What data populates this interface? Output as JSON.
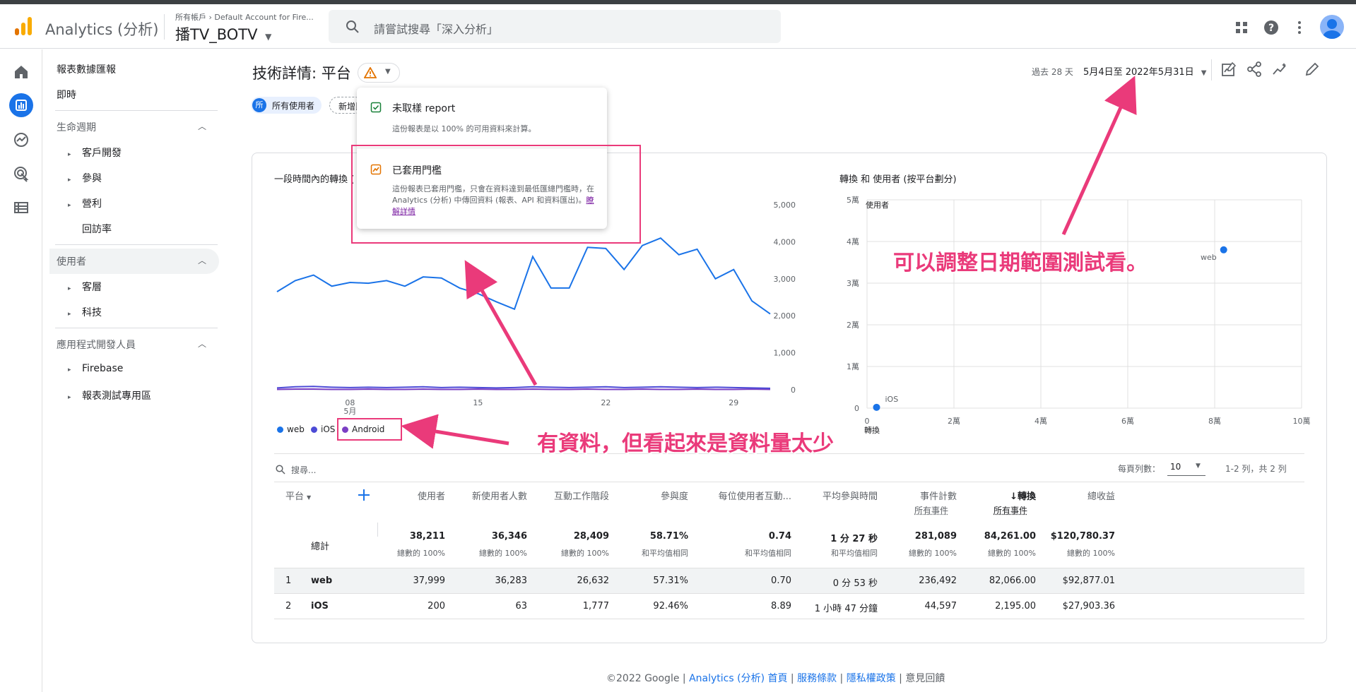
{
  "header": {
    "app_title": "Analytics (分析)",
    "account_path": "所有帳戶 › Default Account for Fire...",
    "property_name": "播TV_BOTV",
    "search_placeholder": "請嘗試搜尋「深入分析」",
    "icons": [
      "apps-icon",
      "help-icon",
      "more-vert-icon",
      "avatar"
    ]
  },
  "rail": [
    "home-icon",
    "reports-icon",
    "explore-icon",
    "advertising-icon",
    "configure-icon"
  ],
  "nav": {
    "reports_snapshot": "報表數據匯報",
    "realtime": "即時",
    "lifecycle": "生命週期",
    "acquisition": "客戶開發",
    "engagement": "參與",
    "monetization": "營利",
    "retention": "回訪率",
    "user": "使用者",
    "demographics": "客層",
    "tech": "科技",
    "app_developer": "應用程式開發人員",
    "firebase": "Firebase",
    "debug": "報表測試專用區"
  },
  "page": {
    "title": "技術詳情: 平台",
    "chip_users_badge": "所",
    "chip_users": "所有使用者",
    "chip_add": "新增比",
    "date_prefix": "過去 28 天",
    "date_range": "5月4日至 2022年5月31日"
  },
  "popup": {
    "unsampled_title": "未取樣 report",
    "unsampled_desc": "這份報表是以 100% 的可用資料來計算。",
    "threshold_title": "已套用門檻",
    "threshold_desc": "這份報表已套用門檻，只會在資料達到最低匯總門檻時，在 Analytics (分析) 中傳回資料 (報表、API 和資料匯出)。",
    "threshold_link": "瞭解詳情"
  },
  "charts": {
    "line_title": "一段時間內的轉換 (",
    "scatter_title": "轉換 和 使用者 (按平台劃分)",
    "legend": [
      {
        "name": "web",
        "color": "#1a73e8"
      },
      {
        "name": "iOS",
        "color": "#4c4bd6"
      },
      {
        "name": "Android",
        "color": "#7b3fc4"
      }
    ]
  },
  "chart_data": [
    {
      "type": "line",
      "x_tick_labels": [
        "08",
        "15",
        "22",
        "29"
      ],
      "x_month_label": "5月",
      "y_tick_labels": [
        "5,000",
        "4,000",
        "3,000",
        "2,000",
        "1,000",
        "0"
      ],
      "ylim": [
        0,
        5000
      ],
      "grid": false,
      "series": [
        {
          "name": "web",
          "color": "#1a73e8",
          "values": [
            2650,
            2950,
            3100,
            2800,
            2900,
            2880,
            2950,
            2800,
            3050,
            3020,
            2750,
            2600,
            2380,
            2180,
            3600,
            2750,
            2750,
            3850,
            3820,
            3250,
            3900,
            4100,
            3650,
            3800,
            3000,
            3250,
            2400,
            2050
          ]
        },
        {
          "name": "iOS",
          "color": "#4c4bd6",
          "values": [
            50,
            80,
            90,
            70,
            60,
            70,
            60,
            70,
            80,
            60,
            70,
            60,
            50,
            60,
            80,
            70,
            60,
            70,
            80,
            60,
            70,
            80,
            70,
            60,
            70,
            60,
            50,
            40
          ]
        },
        {
          "name": "Android",
          "color": "#7b3fc4",
          "values": [
            10,
            20,
            20,
            10,
            10,
            20,
            10,
            10,
            20,
            10,
            10,
            20,
            10,
            10,
            20,
            10,
            10,
            20,
            10,
            10,
            20,
            10,
            10,
            20,
            10,
            10,
            20,
            10
          ]
        }
      ]
    },
    {
      "type": "scatter",
      "xlabel": "",
      "ylabel": "使用者",
      "x_tick_labels": [
        "0",
        "2萬",
        "4萬",
        "6萬",
        "8萬",
        "10萬"
      ],
      "y_tick_labels": [
        "0",
        "1萬",
        "2萬",
        "3萬",
        "4萬",
        "5萬"
      ],
      "xlim": [
        0,
        100000
      ],
      "ylim": [
        0,
        50000
      ],
      "x_axis_label_clipped": "轉換",
      "grid": true,
      "points": [
        {
          "label": "web",
          "x": 82066,
          "y": 37999,
          "color": "#1a73e8"
        },
        {
          "label": "iOS",
          "x": 2195,
          "y": 200,
          "color": "#1a73e8"
        }
      ]
    }
  ],
  "table": {
    "search_placeholder": "搜尋...",
    "rows_per_page_label": "每頁列數：",
    "rows_per_page": "10",
    "range": "1-2 列，共 2 列",
    "platform_header": "平台",
    "headers": [
      "使用者",
      "新使用者人數",
      "互動工作階段",
      "參與度",
      "每位使用者互動...",
      "平均參與時間",
      "事件計數",
      "↓轉換",
      "總收益"
    ],
    "sub_headers": {
      "events": "所有事件",
      "conversions": "所有事件"
    },
    "totals_label": "總計",
    "totals": [
      "38,211",
      "36,346",
      "28,409",
      "58.71%",
      "0.74",
      "1 分 27 秒",
      "281,089",
      "84,261.00",
      "$120,780.37"
    ],
    "totals_sub": [
      "總數的 100%",
      "總數的 100%",
      "總數的 100%",
      "和平均值相同",
      "和平均值相同",
      "和平均值相同",
      "總數的 100%",
      "總數的 100%",
      "總數的 100%"
    ],
    "rows": [
      {
        "idx": "1",
        "name": "web",
        "values": [
          "37,999",
          "36,283",
          "26,632",
          "57.31%",
          "0.70",
          "0 分 53 秒",
          "236,492",
          "82,066.00",
          "$92,877.01"
        ]
      },
      {
        "idx": "2",
        "name": "iOS",
        "values": [
          "200",
          "63",
          "1,777",
          "92.46%",
          "8.89",
          "1 小時 47 分鐘",
          "44,597",
          "2,195.00",
          "$27,903.36"
        ]
      }
    ]
  },
  "footer": {
    "copyright": "©2022 Google",
    "home": "Analytics (分析) 首頁",
    "terms": "服務條款",
    "privacy": "隱私權政策",
    "feedback": "意見回饋"
  },
  "annotations": {
    "date_note": "可以調整日期範圍測試看。",
    "data_note": "有資料，但看起來是資料量太少"
  }
}
